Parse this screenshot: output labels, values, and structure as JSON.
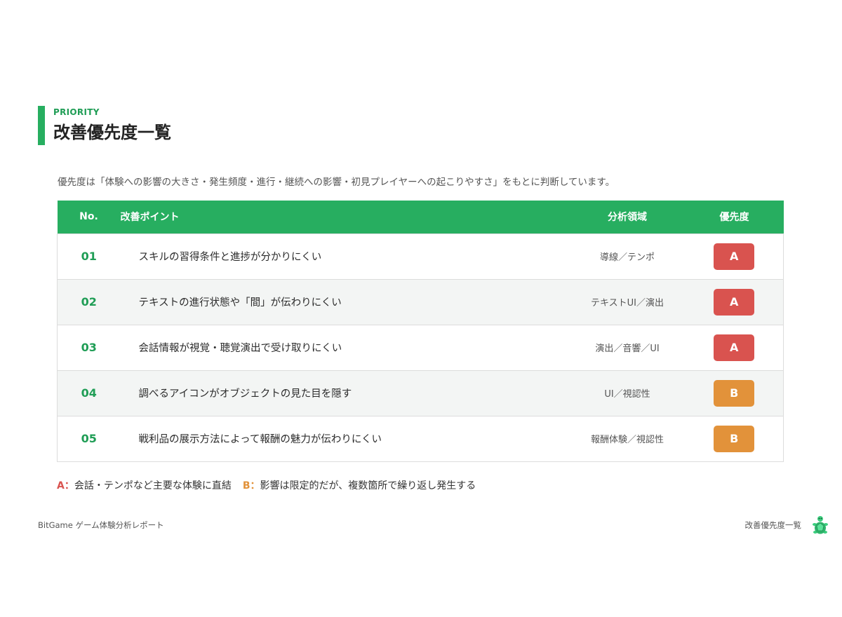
{
  "header": {
    "eyebrow": "PRIORITY",
    "title": "改善優先度一覧"
  },
  "lead": "優先度は「体験への影響の大きさ・発生頻度・進行・継続への影響・初見プレイヤーへの起こりやすさ」をもとに判断しています。",
  "table": {
    "columns": [
      "No.",
      "改善ポイント",
      "分析領域",
      "優先度"
    ],
    "rows": [
      {
        "no": "01",
        "point": "スキルの習得条件と進捗が分かりにくい",
        "area": "導線／テンポ",
        "priority": "A"
      },
      {
        "no": "02",
        "point": "テキストの進行状態や「間」が伝わりにくい",
        "area": "テキストUI／演出",
        "priority": "A"
      },
      {
        "no": "03",
        "point": "会話情報が視覚・聴覚演出で受け取りにくい",
        "area": "演出／音響／UI",
        "priority": "A"
      },
      {
        "no": "04",
        "point": "調べるアイコンがオブジェクトの見た目を隠す",
        "area": "UI／視認性",
        "priority": "B"
      },
      {
        "no": "05",
        "point": "戦利品の展示方法によって報酬の魅力が伝わりにくい",
        "area": "報酬体験／視認性",
        "priority": "B"
      }
    ]
  },
  "legend": {
    "a_key": "A：",
    "a_text": "会話・テンポなど主要な体験に直結",
    "b_key": "B：",
    "b_text": "影響は限定的だが、複数箇所で繰り返し発生する"
  },
  "footer": {
    "left": "BitGame  ゲーム体験分析レポート",
    "right": "改善優先度一覧",
    "logo_icon": "turtle-logo-icon"
  },
  "colors": {
    "accent": "#27ae60",
    "priority_a": "#d9534f",
    "priority_b": "#e2923a"
  }
}
